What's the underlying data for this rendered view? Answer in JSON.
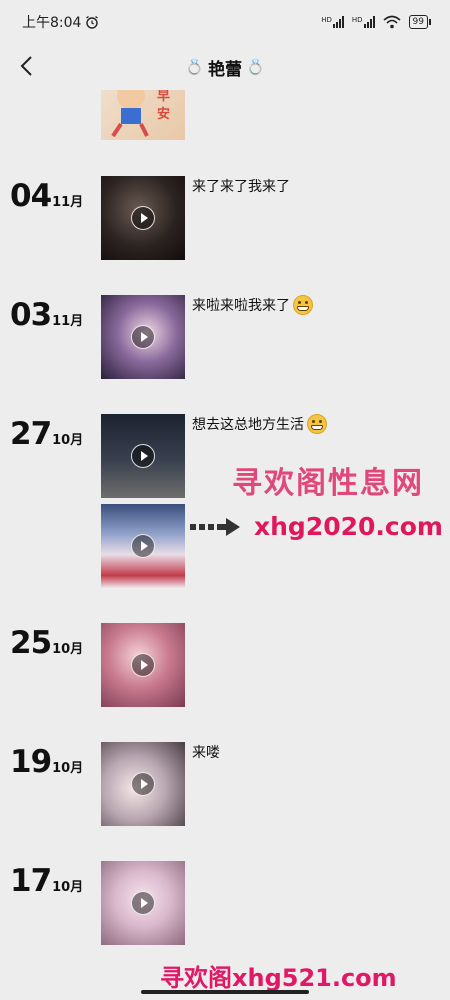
{
  "status_bar": {
    "time": "上午8:04",
    "battery": "99",
    "net1": "HD",
    "net2": "HD"
  },
  "header": {
    "title": "艳蕾"
  },
  "entries": [
    {
      "day": "04",
      "month": "11月",
      "caption": "来了来了我来了"
    },
    {
      "day": "03",
      "month": "11月",
      "caption": "来啦来啦我来了"
    },
    {
      "day": "27",
      "month": "10月",
      "caption": "想去这总地方生活"
    },
    {
      "day": "25",
      "month": "10月",
      "caption": ""
    },
    {
      "day": "19",
      "month": "10月",
      "caption": "来喽"
    },
    {
      "day": "17",
      "month": "10月",
      "caption": ""
    }
  ],
  "watermark": {
    "title": "寻欢阁性息网",
    "url": "xhg2020.com",
    "bottom": "寻欢阁xhg521.com"
  },
  "colors": {
    "background": "#ededed",
    "watermark": "#e0185b"
  }
}
